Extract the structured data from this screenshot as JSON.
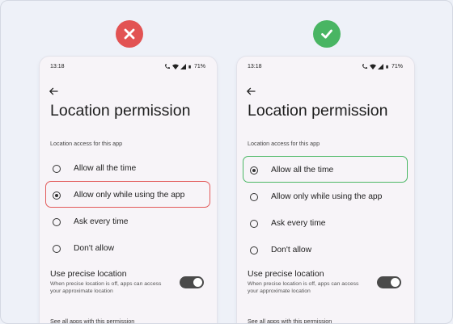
{
  "left": {
    "status_time": "13:18",
    "battery": "71%",
    "title": "Location permission",
    "section_label": "Location access for this app",
    "options": [
      {
        "label": "Allow all the time",
        "selected": false
      },
      {
        "label": "Allow only while using the app",
        "selected": true
      },
      {
        "label": "Ask every time",
        "selected": false
      },
      {
        "label": "Don't allow",
        "selected": false
      }
    ],
    "precise_title": "Use precise location",
    "precise_desc": "When precise location is off, apps can access your approximate location",
    "precise_on": true,
    "see_all": "See all apps with this permission"
  },
  "right": {
    "status_time": "13:18",
    "battery": "71%",
    "title": "Location permission",
    "section_label": "Location access for this app",
    "options": [
      {
        "label": "Allow all the time",
        "selected": true
      },
      {
        "label": "Allow only while using the app",
        "selected": false
      },
      {
        "label": "Ask every time",
        "selected": false
      },
      {
        "label": "Don't allow",
        "selected": false
      }
    ],
    "precise_title": "Use precise location",
    "precise_desc": "When precise location is off, apps can access your approximate location",
    "precise_on": true,
    "see_all": "See all apps with this permission"
  },
  "colors": {
    "bad": "#e25353",
    "good": "#49b563",
    "background": "#eef1f8"
  },
  "icons": {
    "bad_badge": "x-icon",
    "good_badge": "check-icon"
  }
}
